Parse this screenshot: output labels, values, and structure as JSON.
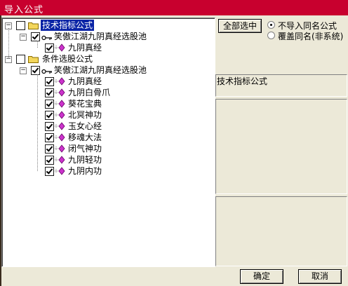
{
  "window": {
    "title": "导入公式"
  },
  "tree": {
    "roots": [
      {
        "label": "技术指标公式",
        "checked": false,
        "selected": true,
        "children": [
          {
            "label": "笑傲江湖九阴真经选股池",
            "checked": true,
            "children": [
              {
                "label": "九阴真经",
                "checked": true
              }
            ]
          }
        ]
      },
      {
        "label": "条件选股公式",
        "checked": false,
        "selected": false,
        "children": [
          {
            "label": "笑傲江湖九阴真经选股池",
            "checked": true,
            "children": [
              {
                "label": "九阴真经",
                "checked": true
              },
              {
                "label": "九阴白骨爪",
                "checked": true
              },
              {
                "label": "葵花宝典",
                "checked": true
              },
              {
                "label": "北冥神功",
                "checked": true
              },
              {
                "label": "玉女心经",
                "checked": true
              },
              {
                "label": "移魂大法",
                "checked": true
              },
              {
                "label": "闭气神功",
                "checked": true
              },
              {
                "label": "九阴轻功",
                "checked": true
              },
              {
                "label": "九阴内功",
                "checked": true
              }
            ]
          }
        ]
      }
    ]
  },
  "select_all_label": "全部选中",
  "radio_options": [
    {
      "label": "不导入同名公式",
      "selected": true
    },
    {
      "label": "覆盖同名(非系统)",
      "selected": false
    }
  ],
  "info_title": "技术指标公式",
  "buttons": {
    "ok": "确定",
    "cancel": "取消"
  },
  "colors": {
    "titlebar": "#c8002e",
    "selection": "#0a24a6",
    "folder": "#f3d65b",
    "gem": "#cc33cc"
  }
}
